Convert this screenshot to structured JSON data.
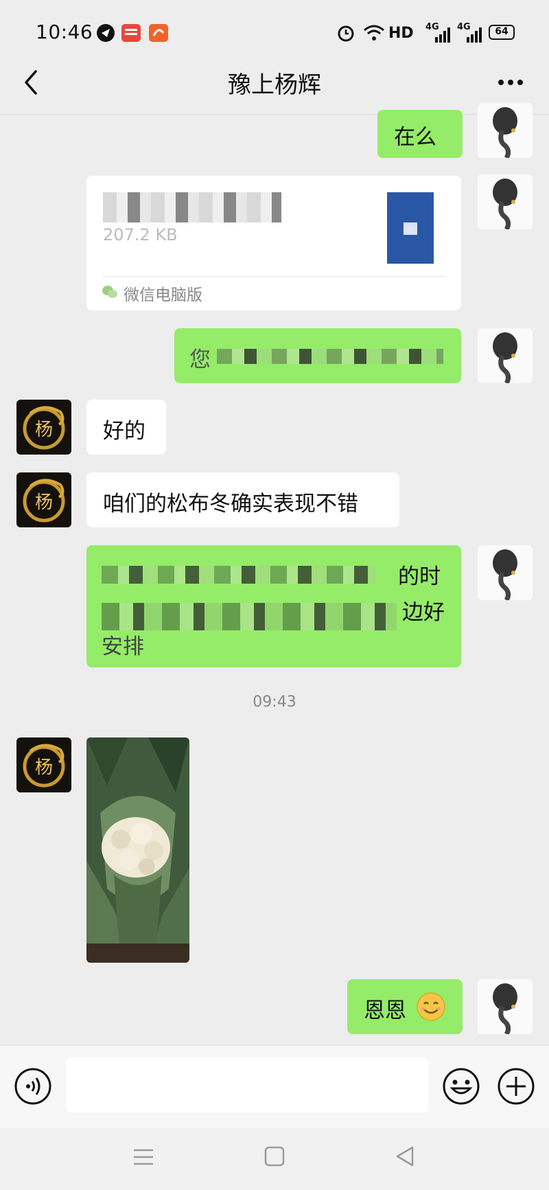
{
  "status_bar": {
    "time": "10:46",
    "network": "HD",
    "signal1": "4G",
    "signal2": "4G",
    "battery": "64"
  },
  "header": {
    "title": "豫上杨辉"
  },
  "messages": {
    "m1_text": "在么",
    "file_size": "207.2 KB",
    "file_source": "微信电脑版",
    "m3_text": "您",
    "m4_text": "好的",
    "m5_text": "咱们的松布冬确实表现不错",
    "m6_text_a": "的时",
    "m6_text_b": "边好",
    "m6_text_c": "安排",
    "timestamp": "09:43",
    "m8_text": "恩恩"
  },
  "colors": {
    "bubble_self": "#95ec69",
    "bubble_other": "#ffffff",
    "background": "#ededed"
  },
  "icons": [
    "back-icon",
    "more-icon",
    "voice-icon",
    "emoji-icon",
    "plus-icon",
    "menu-nav-icon",
    "home-nav-icon",
    "back-nav-icon"
  ]
}
